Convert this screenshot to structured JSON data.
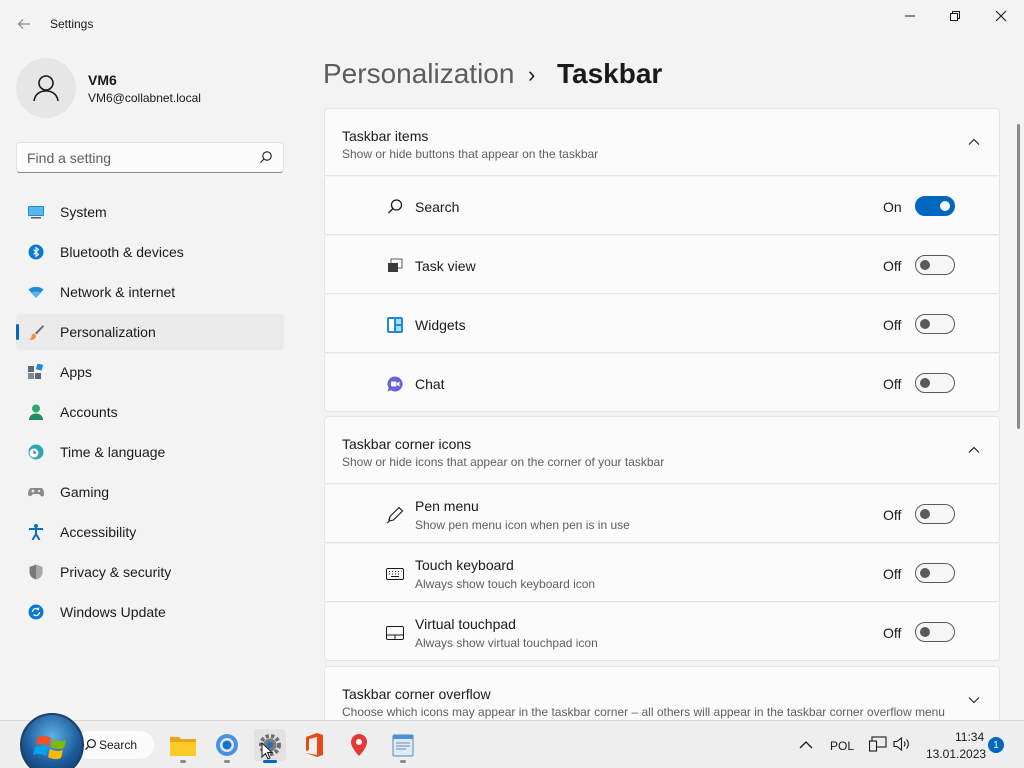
{
  "window": {
    "title": "Settings",
    "controls": {
      "minimize": "—",
      "maximize": "❐",
      "close": "✕"
    }
  },
  "profile": {
    "name": "VM6",
    "email": "VM6@collabnet.local"
  },
  "search": {
    "placeholder": "Find a setting"
  },
  "sidebar": {
    "items": [
      {
        "label": "System",
        "icon": "system-icon"
      },
      {
        "label": "Bluetooth & devices",
        "icon": "bluetooth-icon"
      },
      {
        "label": "Network & internet",
        "icon": "wifi-icon"
      },
      {
        "label": "Personalization",
        "icon": "brush-icon",
        "active": true
      },
      {
        "label": "Apps",
        "icon": "apps-icon"
      },
      {
        "label": "Accounts",
        "icon": "accounts-icon"
      },
      {
        "label": "Time & language",
        "icon": "clock-globe-icon"
      },
      {
        "label": "Gaming",
        "icon": "gamepad-icon"
      },
      {
        "label": "Accessibility",
        "icon": "accessibility-icon"
      },
      {
        "label": "Privacy & security",
        "icon": "shield-icon"
      },
      {
        "label": "Windows Update",
        "icon": "update-icon"
      }
    ]
  },
  "breadcrumb": {
    "parent": "Personalization",
    "separator": "›",
    "current": "Taskbar"
  },
  "sections": {
    "taskbar_items": {
      "title": "Taskbar items",
      "description": "Show or hide buttons that appear on the taskbar",
      "rows": [
        {
          "label": "Search",
          "state": "On",
          "on": true,
          "icon": "search-icon"
        },
        {
          "label": "Task view",
          "state": "Off",
          "on": false,
          "icon": "task-view-icon"
        },
        {
          "label": "Widgets",
          "state": "Off",
          "on": false,
          "icon": "widgets-icon"
        },
        {
          "label": "Chat",
          "state": "Off",
          "on": false,
          "icon": "chat-icon"
        }
      ]
    },
    "corner_icons": {
      "title": "Taskbar corner icons",
      "description": "Show or hide icons that appear on the corner of your taskbar",
      "rows": [
        {
          "label": "Pen menu",
          "description": "Show pen menu icon when pen is in use",
          "state": "Off",
          "on": false,
          "icon": "pen-icon"
        },
        {
          "label": "Touch keyboard",
          "description": "Always show touch keyboard icon",
          "state": "Off",
          "on": false,
          "icon": "keyboard-icon"
        },
        {
          "label": "Virtual touchpad",
          "description": "Always show virtual touchpad icon",
          "state": "Off",
          "on": false,
          "icon": "touchpad-icon"
        }
      ]
    },
    "corner_overflow": {
      "title": "Taskbar corner overflow",
      "description": "Choose which icons may appear in the taskbar corner – all others will appear in the taskbar corner overflow menu"
    }
  },
  "taskbar": {
    "search_label": "Search",
    "apps": [
      "file-explorer-icon",
      "chrome-icon",
      "settings-icon",
      "office-icon",
      "maps-icon",
      "notepad-icon"
    ],
    "language": "POL",
    "time": "11:34",
    "date": "13.01.2023",
    "notification_count": "1"
  },
  "colors": {
    "accent": "#0067c0",
    "background": "#f3f3f3",
    "card": "#fbfbfb"
  }
}
